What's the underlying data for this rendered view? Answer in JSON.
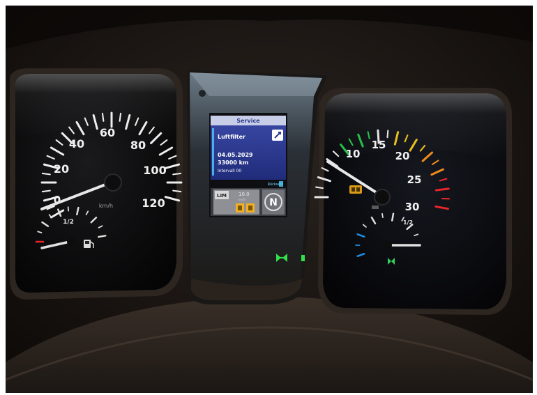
{
  "left_gauge": {
    "speed_ticks": [
      "20",
      "40",
      "60",
      "80",
      "100",
      "120"
    ],
    "zero_tick": "0",
    "unit": "km/h",
    "fuel_half": "1/2",
    "needle_color": "#e8e8e8"
  },
  "right_gauge": {
    "rpm_ticks": [
      "10",
      "15",
      "20",
      "25",
      "30"
    ],
    "temp_half": "1/2",
    "zone_colors": {
      "normal": "#e6e6e6",
      "green": "#22c24a",
      "yellow": "#e8c020",
      "orange": "#f08a1c",
      "red": "#e8262a",
      "blue": "#1e8fe0"
    }
  },
  "display": {
    "header": "Service",
    "title": "Luftfilter",
    "date": "04.05.2029",
    "km": "33000 km",
    "interval": "Intervall 00",
    "hint": "Rücksetz",
    "lim_label": "LIM",
    "lim_value": "10.0",
    "lim_unit": "km/h",
    "gear": "N",
    "accent": "#2b3a8c"
  },
  "indicators": {
    "left_light": "arrow-icon",
    "right_light": "green-dot-icon",
    "light_color": "#33e04a"
  }
}
